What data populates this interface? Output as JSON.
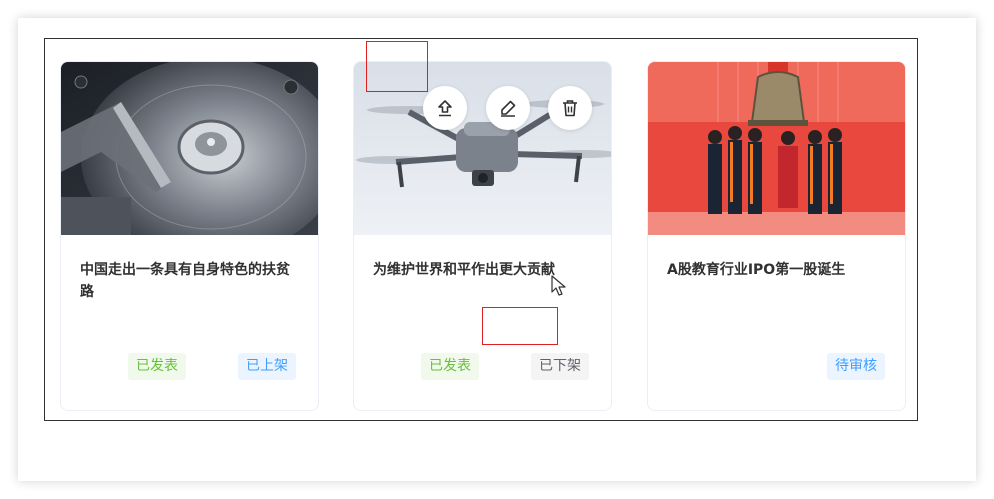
{
  "colors": {
    "success_text": "#67c23a",
    "success_bg": "#f0f9eb",
    "primary_text": "#409eff",
    "primary_bg": "#ecf5ff",
    "info_text": "#606266",
    "info_bg": "#f4f4f5",
    "highlight": "#e02020"
  },
  "cards": [
    {
      "title": "中国走出一条具有自身特色的扶贫路",
      "image": "hard-drive-photo",
      "tags": [
        "已发表",
        "已上架"
      ]
    },
    {
      "title": "为维护世界和平作出更大贡献",
      "image": "drone-photo",
      "tags": [
        "已发表",
        "已下架"
      ],
      "actions": [
        "upload-icon",
        "edit-icon",
        "delete-icon"
      ]
    },
    {
      "title": "A股教育行业IPO第一股诞生",
      "image": "bell-ringing-ceremony-photo",
      "tags": [
        "待审核"
      ]
    }
  ]
}
